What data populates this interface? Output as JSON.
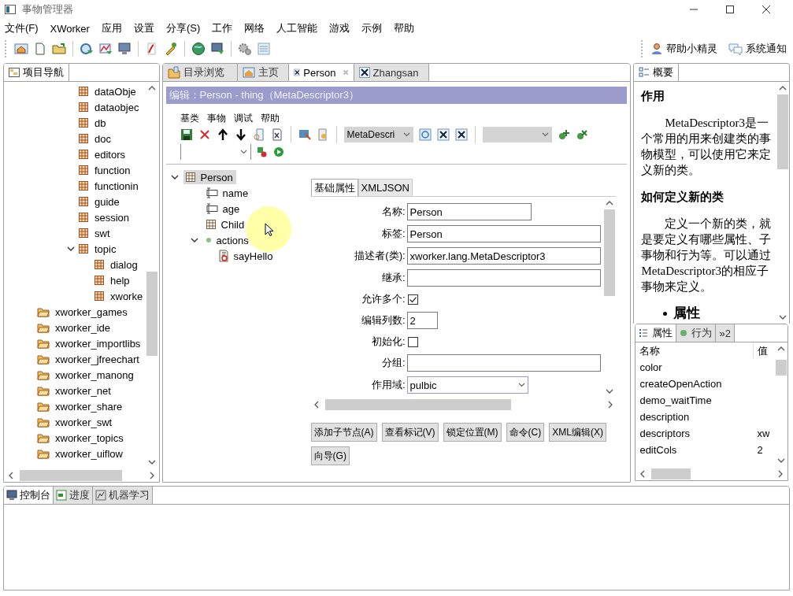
{
  "window": {
    "title": "事物管理器"
  },
  "menu": [
    "文件(F)",
    "XWorker",
    "应用",
    "设置",
    "分享(S)",
    "工作",
    "网络",
    "人工智能",
    "游戏",
    "示例",
    "帮助"
  ],
  "toolbar_links": [
    "帮助小精灵",
    "系统通知"
  ],
  "nav_panel": {
    "tab": "项目导航",
    "nested_items": [
      {
        "label": "dataObje"
      },
      {
        "label": "dataobjec"
      },
      {
        "label": "db"
      },
      {
        "label": "doc"
      },
      {
        "label": "editors"
      },
      {
        "label": "function"
      },
      {
        "label": "functionin"
      },
      {
        "label": "guide"
      },
      {
        "label": "session"
      },
      {
        "label": "swt"
      },
      {
        "label": "topic",
        "expanded": true,
        "children": [
          {
            "label": "dialog"
          },
          {
            "label": "help"
          },
          {
            "label": "xworke"
          }
        ]
      }
    ],
    "items": [
      {
        "label": "xworker_games"
      },
      {
        "label": "xworker_ide"
      },
      {
        "label": "xworker_importlibs"
      },
      {
        "label": "xworker_jfreechart"
      },
      {
        "label": "xworker_manong"
      },
      {
        "label": "xworker_net"
      },
      {
        "label": "xworker_share"
      },
      {
        "label": "xworker_swt"
      },
      {
        "label": "xworker_topics"
      },
      {
        "label": "xworker_uiflow"
      }
    ]
  },
  "editor_tabs": [
    {
      "label": "目录浏览",
      "kind": "folder",
      "selected": false
    },
    {
      "label": "主页",
      "kind": "home",
      "selected": false
    },
    {
      "label": "Person",
      "kind": "thing",
      "selected": true
    },
    {
      "label": "Zhangsan",
      "kind": "thing",
      "selected": false
    }
  ],
  "editor": {
    "header": "编辑：Person - thing（MetaDescriptor3）",
    "menu": [
      "基类",
      "事物",
      "调试",
      "帮助"
    ],
    "descriptor_combo": "MetaDescri",
    "tree": {
      "label": "Person",
      "kind": "thing",
      "selected": true,
      "expanded": true,
      "children": [
        {
          "label": "name",
          "kind": "attribute",
          "selected": false
        },
        {
          "label": "age",
          "kind": "attribute",
          "selected": false
        },
        {
          "label": "Child",
          "kind": "thing",
          "selected": false
        },
        {
          "label": "actions",
          "kind": "actions",
          "selected": false,
          "expanded": true,
          "children": [
            {
              "label": "sayHello",
              "kind": "action",
              "selected": false
            }
          ]
        }
      ]
    },
    "form_tabs": [
      {
        "label": "基础属性",
        "selected": true
      },
      {
        "label": "XMLJSON",
        "selected": false
      }
    ],
    "fields": [
      {
        "label": "名称:",
        "kind": "short_text",
        "value": "Person"
      },
      {
        "label": "标签:",
        "kind": "text",
        "value": "Person"
      },
      {
        "label": "描述者(类):",
        "kind": "text",
        "value": "xworker.lang.MetaDescriptor3"
      },
      {
        "label": "继承:",
        "kind": "text"
      },
      {
        "label": "允许多个:",
        "kind": "checkbox",
        "checked": true
      },
      {
        "label": "编辑列数:",
        "kind": "number",
        "value": "2"
      },
      {
        "label": "初始化:",
        "kind": "checkbox",
        "checked": false
      },
      {
        "label": "分组:",
        "kind": "text"
      },
      {
        "label": "作用域:",
        "kind": "select",
        "value": "pulbic"
      }
    ],
    "buttons": [
      "添加子节点(A)",
      "查看标记(V)",
      "锁定位置(M)",
      "命令(C)",
      "XML编辑(X)",
      "向导(G)"
    ]
  },
  "overview": {
    "tab": "概要",
    "sections": [
      {
        "heading": "作用",
        "text": "MetaDescriptor3是一个常用的用来创建类的事物模型，可以使用它来定义新的类。"
      },
      {
        "heading": "如何定义新的类",
        "text": "定义一个新的类，就是要定义有哪些属性、子事物和行为等。可以通过MetaDescriptor3的相应子事物来定义。"
      }
    ],
    "bullets": [
      "属性"
    ]
  },
  "properties": {
    "tabs": [
      {
        "label": "属性",
        "kind": "list",
        "selected": true
      },
      {
        "label": "行为",
        "kind": "dot",
        "selected": false
      },
      {
        "label": "»2",
        "kind": "more",
        "selected": false
      }
    ],
    "columns": [
      "名称",
      "值"
    ],
    "rows": [
      [
        "color",
        ""
      ],
      [
        "createOpenAction",
        ""
      ],
      [
        "demo_waitTime",
        ""
      ],
      [
        "description",
        ""
      ],
      [
        "descriptors",
        "xw"
      ],
      [
        "editCols",
        "2"
      ]
    ]
  },
  "bottom_tabs": [
    {
      "label": "控制台",
      "kind": "console",
      "selected": true
    },
    {
      "label": "进度",
      "kind": "progress",
      "selected": false
    },
    {
      "label": "机器学习",
      "kind": "ml",
      "selected": false
    }
  ]
}
